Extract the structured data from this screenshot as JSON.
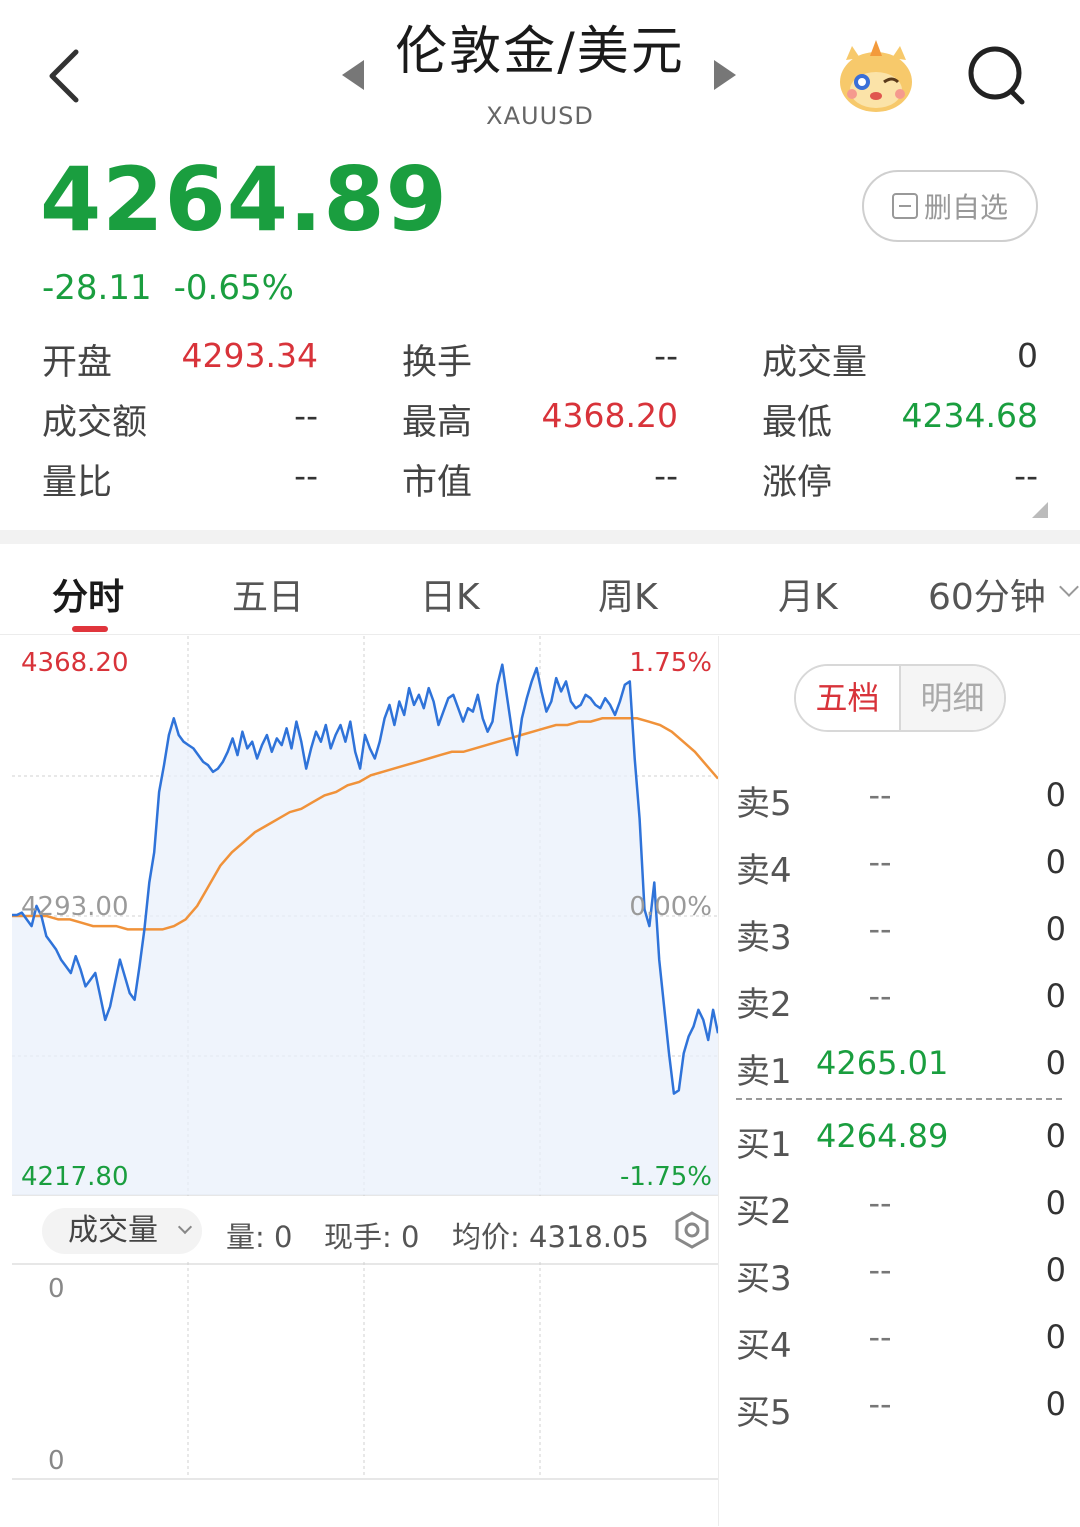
{
  "header": {
    "title": "伦敦金/美元",
    "subtitle": "XAUUSD",
    "icons": {
      "back": "back-chevron-icon",
      "prev": "prev-arrow-icon",
      "next": "next-arrow-icon",
      "mascot": "mascot-avatar-icon",
      "search": "search-icon"
    }
  },
  "quote": {
    "price": "4264.89",
    "change": "-28.11",
    "change_pct": "-0.65%",
    "watch_label": "删自选"
  },
  "stats": {
    "open_label": "开盘",
    "open_value": "4293.34",
    "turnover_label": "换手",
    "turnover_value": "--",
    "volume_label": "成交量",
    "volume_value": "0",
    "amount_label": "成交额",
    "amount_value": "--",
    "high_label": "最高",
    "high_value": "4368.20",
    "low_label": "最低",
    "low_value": "4234.68",
    "vol_ratio_label": "量比",
    "vol_ratio_value": "--",
    "mktcap_label": "市值",
    "mktcap_value": "--",
    "limit_up_label": "涨停",
    "limit_up_value": "--"
  },
  "tabs": [
    "分时",
    "五日",
    "日K",
    "周K",
    "月K",
    "60分钟"
  ],
  "chart": {
    "y_top": "4368.20",
    "y_mid": "4293.00",
    "y_bottom": "4217.80",
    "pct_top": "1.75%",
    "pct_mid": "0.00%",
    "pct_bottom": "-1.75%",
    "colors": {
      "price_line": "#2f73d9",
      "avg_line": "#f0923a",
      "up": "#d8333a",
      "down": "#1a9e3f"
    }
  },
  "chart_data": {
    "type": "line",
    "ylim": [
      4217.8,
      4368.2
    ],
    "series": [
      {
        "values": [
          4293.3,
          4293.3,
          4294,
          4292,
          4290,
          4296,
          4293,
          4287,
          4285,
          4283,
          4280,
          4278,
          4276,
          4281,
          4277,
          4272,
          4274,
          4276,
          4269,
          4262,
          4266,
          4273,
          4280,
          4275,
          4270,
          4268,
          4278,
          4289,
          4303,
          4312,
          4330,
          4338,
          4347,
          4352,
          4347,
          4345,
          4344,
          4343,
          4341,
          4339,
          4338,
          4336,
          4337,
          4339,
          4342,
          4346,
          4341,
          4348,
          4343,
          4345,
          4340,
          4344,
          4347,
          4342,
          4346,
          4344,
          4349,
          4343,
          4351,
          4345,
          4337,
          4343,
          4348,
          4345,
          4350,
          4343,
          4347,
          4350,
          4345,
          4351,
          4342,
          4337,
          4347,
          4343,
          4340,
          4345,
          4352,
          4356,
          4350,
          4357,
          4353,
          4361,
          4356,
          4359,
          4355,
          4361,
          4357,
          4350,
          4354,
          4358,
          4359,
          4355,
          4351,
          4355,
          4354,
          4359,
          4352,
          4348,
          4351,
          4362,
          4368,
          4358,
          4348,
          4341,
          4352,
          4358,
          4363,
          4367,
          4360,
          4354,
          4357,
          4364,
          4360,
          4363,
          4357,
          4355,
          4356,
          4359,
          4358,
          4356,
          4355,
          4358,
          4356,
          4353,
          4357,
          4362,
          4363,
          4340,
          4322,
          4295,
          4290,
          4303,
          4280,
          4266,
          4252,
          4240,
          4241,
          4252,
          4257,
          4260,
          4265,
          4262,
          4256,
          4265,
          4258
        ]
      },
      {
        "values": [
          4293,
          4293,
          4293,
          4293,
          4292,
          4292,
          4291,
          4290,
          4290,
          4290,
          4289,
          4289,
          4289,
          4289,
          4290,
          4292,
          4296,
          4302,
          4308,
          4312,
          4315,
          4318,
          4320,
          4322,
          4324,
          4325,
          4327,
          4329,
          4330,
          4332,
          4333,
          4335,
          4336,
          4337,
          4338,
          4339,
          4340,
          4341,
          4342,
          4342,
          4343,
          4344,
          4345,
          4346,
          4347,
          4348,
          4349,
          4350,
          4350,
          4351,
          4351,
          4352,
          4352,
          4352,
          4352,
          4351,
          4350,
          4348,
          4345,
          4342,
          4338,
          4334
        ]
      }
    ]
  },
  "volume_panel": {
    "selector_label": "成交量",
    "vol_text": "量: 0",
    "hand_text": "现手: 0",
    "avg_text": "均价: 4318.05",
    "top_value": "0",
    "bottom_value": "0"
  },
  "order_book": {
    "tab_active": "五档",
    "tab_inactive": "明细",
    "asks": [
      {
        "label": "卖5",
        "price": "--",
        "qty": "0"
      },
      {
        "label": "卖4",
        "price": "--",
        "qty": "0"
      },
      {
        "label": "卖3",
        "price": "--",
        "qty": "0"
      },
      {
        "label": "卖2",
        "price": "--",
        "qty": "0"
      },
      {
        "label": "卖1",
        "price": "4265.01",
        "qty": "0"
      }
    ],
    "bids": [
      {
        "label": "买1",
        "price": "4264.89",
        "qty": "0"
      },
      {
        "label": "买2",
        "price": "--",
        "qty": "0"
      },
      {
        "label": "买3",
        "price": "--",
        "qty": "0"
      },
      {
        "label": "买4",
        "price": "--",
        "qty": "0"
      },
      {
        "label": "买5",
        "price": "--",
        "qty": "0"
      }
    ]
  }
}
